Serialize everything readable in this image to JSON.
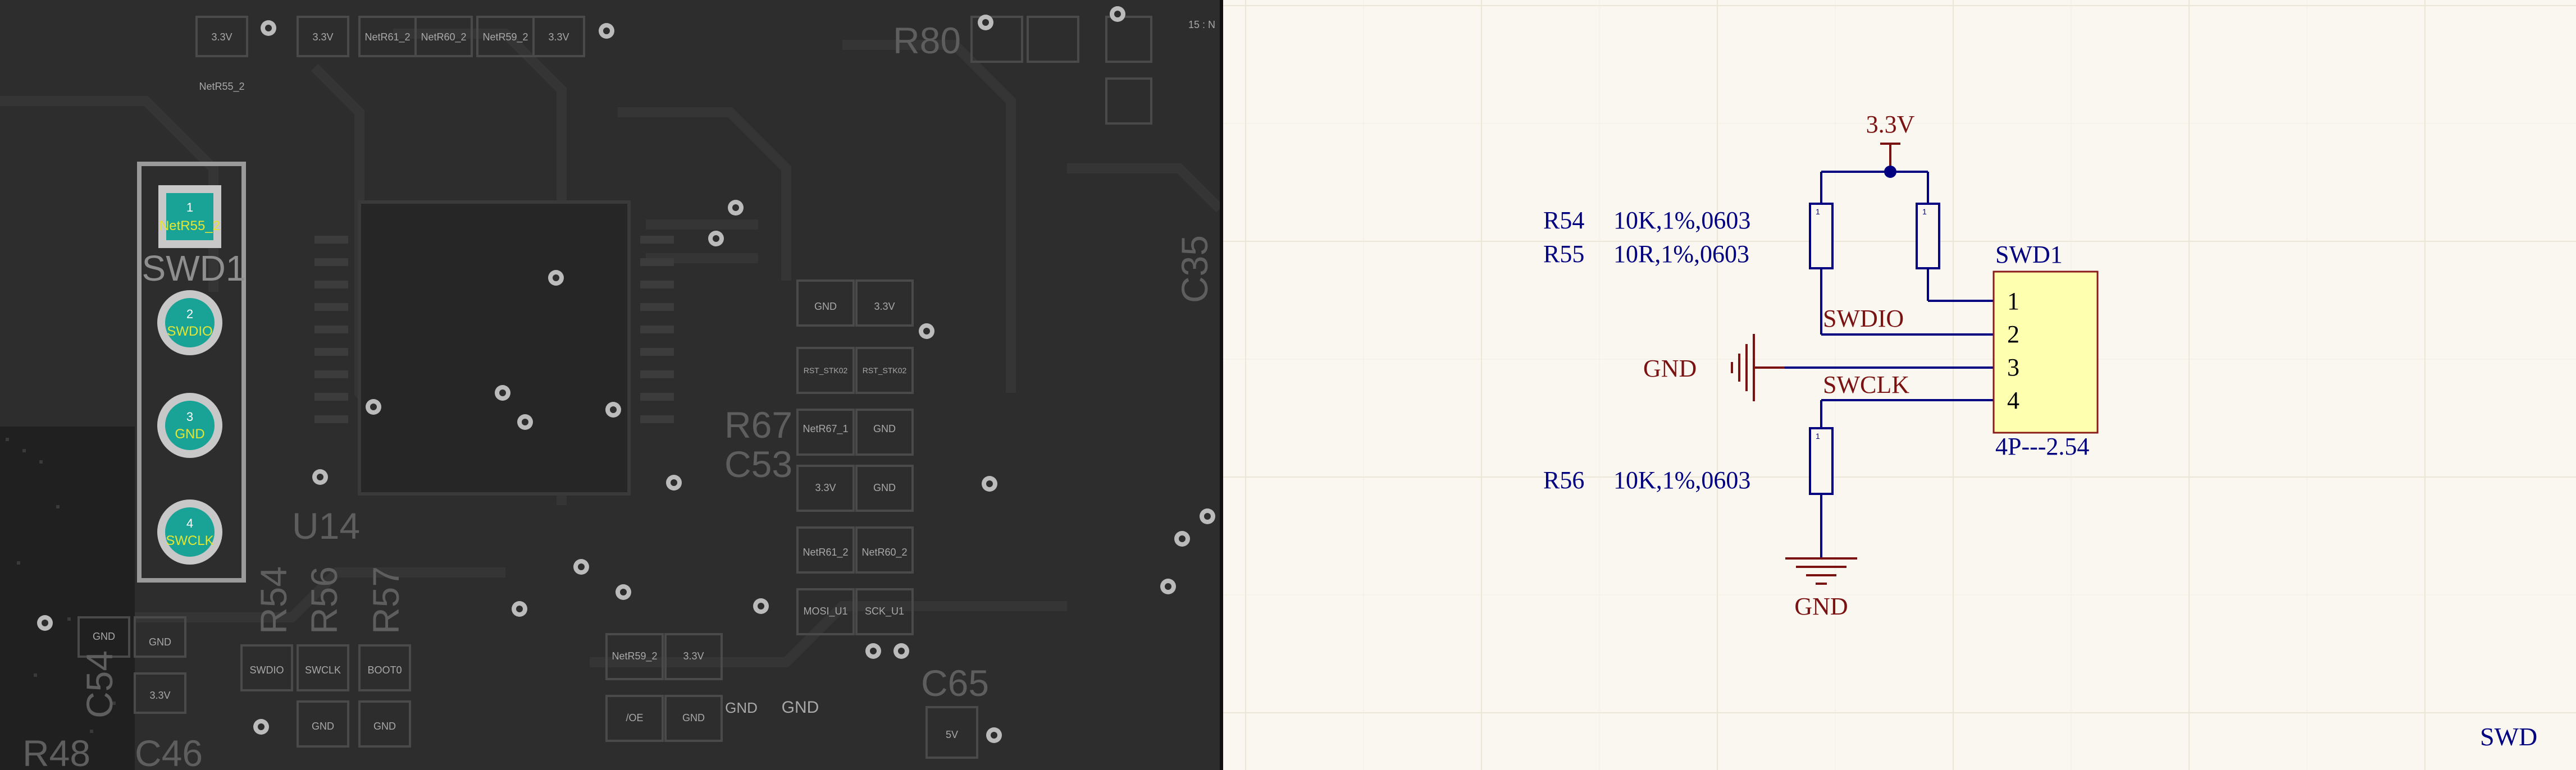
{
  "pcb": {
    "component": "SWD1",
    "pads": [
      {
        "num": "1",
        "net": "NetR55_2"
      },
      {
        "num": "2",
        "net": "SWDIO"
      },
      {
        "num": "3",
        "net": "GND"
      },
      {
        "num": "4",
        "net": "SWCLK"
      }
    ],
    "silkscreen": [
      "R80",
      "R67",
      "C53",
      "U14",
      "R54",
      "R56",
      "R57",
      "R48",
      "C54",
      "C46",
      "C65",
      "C35"
    ],
    "pad_labels": [
      "3.3V",
      "3.3V",
      "NetR61_2",
      "NetR60_2",
      "NetR59_2",
      "3.3V",
      "NetR55_2",
      "GND",
      "3.3V",
      "RST_STK02",
      "RST_STK02",
      "NetR67_1",
      "GND",
      "3.3V",
      "GND",
      "NetR61_2",
      "NetR60_2",
      "MOSI_U1",
      "SCK_U1",
      "SWDIO",
      "SWCLK",
      "BOOT0",
      "GND",
      "GND",
      "NetR59_2",
      "3.3V",
      "/OE",
      "GND",
      "GND",
      "GND",
      "GND",
      "GND",
      "3.3V",
      "5V",
      "15 : N"
    ],
    "colors": {
      "pad": "#18a396",
      "pad_ring": "#c8c8c8",
      "silk": "#5e5e5e",
      "board": "#2d2d2d"
    }
  },
  "schematic": {
    "power_label": "3.3V",
    "gnd_label_left": "GND",
    "gnd_label_bottom": "GND",
    "r54": {
      "designator": "R54",
      "value": "10K,1%,0603"
    },
    "r55": {
      "designator": "R55",
      "value": "10R,1%,0603"
    },
    "r56": {
      "designator": "R56",
      "value": "10K,1%,0603"
    },
    "resistor_pin": "1",
    "connector": {
      "designator": "SWD1",
      "footprint": "4P---2.54",
      "pins": [
        "1",
        "2",
        "3",
        "4"
      ]
    },
    "net_swdio": "SWDIO",
    "net_swclk": "SWCLK",
    "sheet_title": "SWD",
    "colors": {
      "wire": "#000080",
      "component": "#000080",
      "power": "#7a1212",
      "connector_fill": "#ffffb0",
      "connector_border": "#8b1a1a",
      "background": "#f9f7ef"
    }
  }
}
